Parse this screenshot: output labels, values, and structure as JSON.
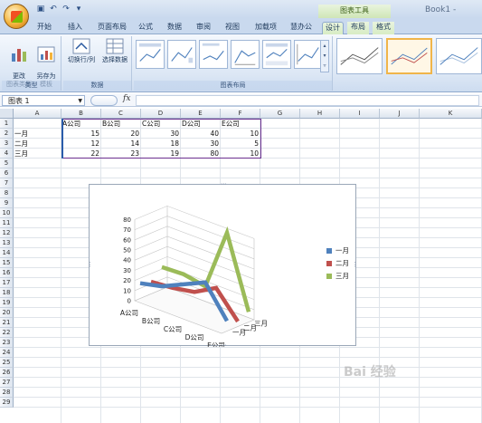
{
  "window": {
    "title": "Book1 - ",
    "context_tools": "图表工具"
  },
  "tabs": [
    "开始",
    "插入",
    "页面布局",
    "公式",
    "数据",
    "审阅",
    "视图",
    "加载项",
    "慧办公",
    "设计",
    "布局",
    "格式"
  ],
  "ribbon": {
    "group_type": {
      "label": "类型",
      "change_type": "更改\n图表类型",
      "save_template": "另存为\n模板"
    },
    "group_data": {
      "label": "数据",
      "switch": "切换行/列",
      "select": "选择数据"
    },
    "group_layout": {
      "label": "图表布局"
    }
  },
  "formula_bar": {
    "name_box": "图表 1",
    "fx": "fx"
  },
  "sheet": {
    "columns": [
      "A",
      "B",
      "C",
      "D",
      "E",
      "F",
      "G",
      "H",
      "I",
      "J",
      "K"
    ],
    "rows": [
      "1",
      "2",
      "3",
      "4",
      "5",
      "6",
      "7",
      "8",
      "9",
      "10",
      "11",
      "12",
      "13",
      "14",
      "15",
      "16",
      "17",
      "18",
      "19",
      "20",
      "21",
      "22",
      "23",
      "24",
      "25",
      "26",
      "27",
      "28",
      "29"
    ],
    "header_row": [
      "",
      "A公司",
      "B公司",
      "C公司",
      "D公司",
      "E公司"
    ],
    "data_rows": [
      {
        "label": "一月",
        "values": [
          "15",
          "20",
          "30",
          "40",
          "10"
        ]
      },
      {
        "label": "二月",
        "values": [
          "12",
          "14",
          "18",
          "30",
          "5"
        ]
      },
      {
        "label": "三月",
        "values": [
          "22",
          "23",
          "19",
          "80",
          "10"
        ]
      }
    ]
  },
  "chart_data": {
    "type": "line",
    "categories": [
      "A公司",
      "B公司",
      "C公司",
      "D公司",
      "E公司"
    ],
    "series": [
      {
        "name": "一月",
        "values": [
          15,
          20,
          30,
          40,
          10
        ],
        "color": "#4f81bd"
      },
      {
        "name": "二月",
        "values": [
          12,
          14,
          18,
          30,
          5
        ],
        "color": "#c0504d"
      },
      {
        "name": "三月",
        "values": [
          22,
          23,
          19,
          80,
          10
        ],
        "color": "#9bbb59"
      }
    ],
    "yticks": [
      "0",
      "10",
      "20",
      "30",
      "40",
      "50",
      "60",
      "70",
      "80"
    ],
    "ylim": [
      0,
      80
    ],
    "depth_labels": [
      "三月",
      "二月",
      "一月"
    ],
    "legend_position": "right"
  },
  "watermark": "Bai 经验"
}
